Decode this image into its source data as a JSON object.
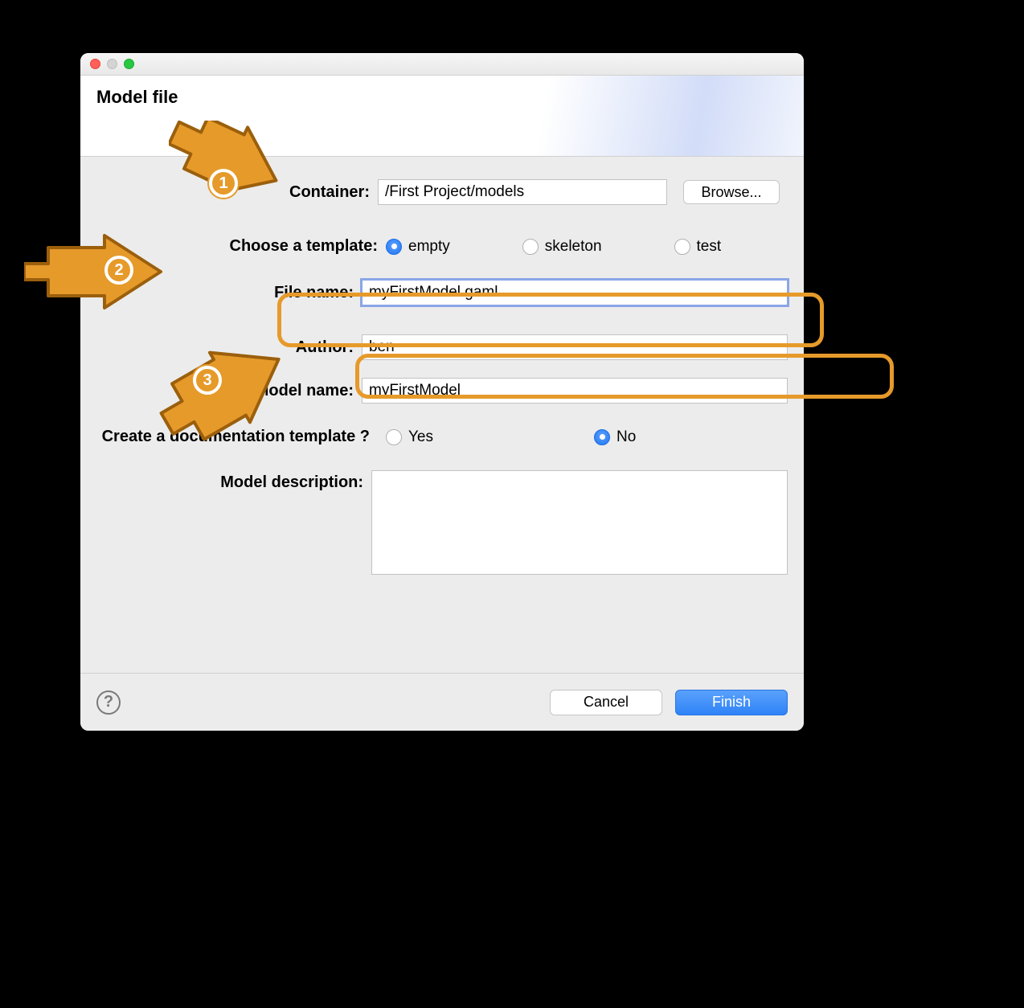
{
  "header": {
    "title": "Model file"
  },
  "labels": {
    "container": "Container:",
    "template": "Choose a template:",
    "filename": "File name:",
    "author": "Author:",
    "modelname": "Model name:",
    "doc": "Create a documentation template ?",
    "description": "Model description:"
  },
  "fields": {
    "container": "/First Project/models",
    "filename": "myFirstModel.gaml",
    "author": "ben",
    "modelname": "myFirstModel",
    "description": ""
  },
  "buttons": {
    "browse": "Browse...",
    "cancel": "Cancel",
    "finish": "Finish"
  },
  "templates": {
    "options": [
      "empty",
      "skeleton",
      "test"
    ],
    "selected": "empty"
  },
  "doc": {
    "options": [
      "Yes",
      "No"
    ],
    "selected": "No"
  },
  "annotations": {
    "badge1": "1",
    "badge2": "2",
    "badge3": "3"
  },
  "help_icon": "?"
}
